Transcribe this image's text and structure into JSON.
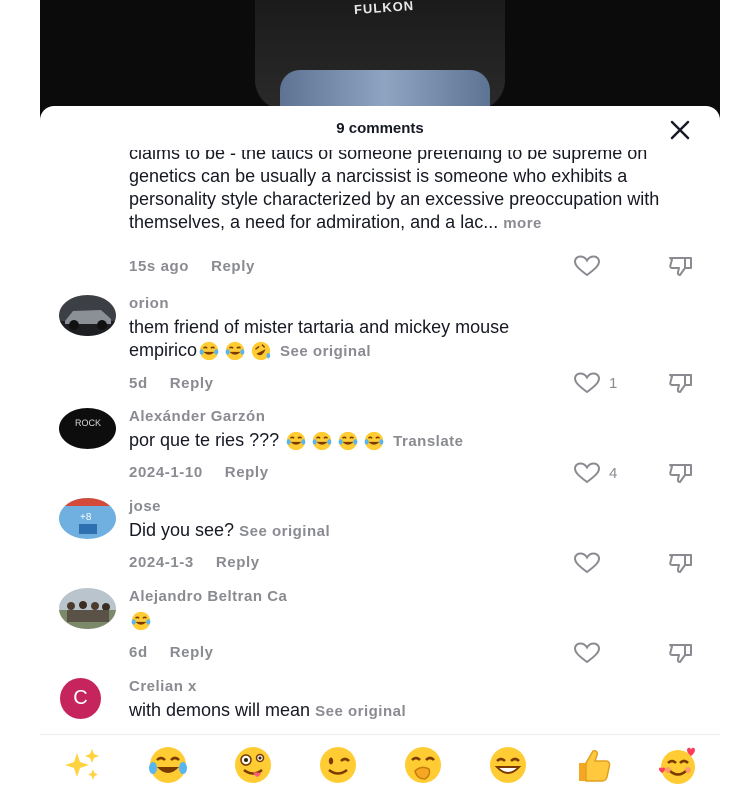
{
  "video": {
    "shirt_text": "FULKON"
  },
  "header": {
    "title": "9 comments"
  },
  "comments": [
    {
      "username": "",
      "text": "claims to be - the tatics of someone pretending to be supreme on genetics can be usually a narcissist is someone who exhibits a personality style characterized by an excessive preoccupation with themselves, a need for admiration, and a lac...",
      "more_label": "more",
      "time": "15s ago",
      "reply_label": "Reply",
      "likes": ""
    },
    {
      "username": "orion",
      "text_line1": "them friend of mister tartaria and mickey mouse",
      "text_line2": "empirico",
      "action_label": "See original",
      "time": "5d",
      "reply_label": "Reply",
      "likes": "1"
    },
    {
      "username": "Alexánder Garzón",
      "text": "por que te ries ???",
      "action_label": "Translate",
      "time": "2024-1-10",
      "reply_label": "Reply",
      "likes": "4"
    },
    {
      "username": "jose",
      "text": "Did you see?",
      "action_label": "See original",
      "time": "2024-1-3",
      "reply_label": "Reply",
      "likes": ""
    },
    {
      "username": "Alejandro Beltran Ca",
      "text": "",
      "time": "6d",
      "reply_label": "Reply",
      "likes": ""
    },
    {
      "username": "Crelian x",
      "avatar_letter": "C",
      "text": "with demons will mean",
      "action_label": "See original"
    }
  ],
  "emoji_bar": [
    "sparkles-icon",
    "tears-of-joy-icon",
    "zany-face-icon",
    "winking-face-icon",
    "hand-over-mouth-icon",
    "grinning-face-icon",
    "thumbs-up-icon",
    "smiling-hearts-icon"
  ],
  "colors": {
    "muted": "#8a8b91",
    "text": "#161823",
    "avatar_c": "#c5245d"
  }
}
